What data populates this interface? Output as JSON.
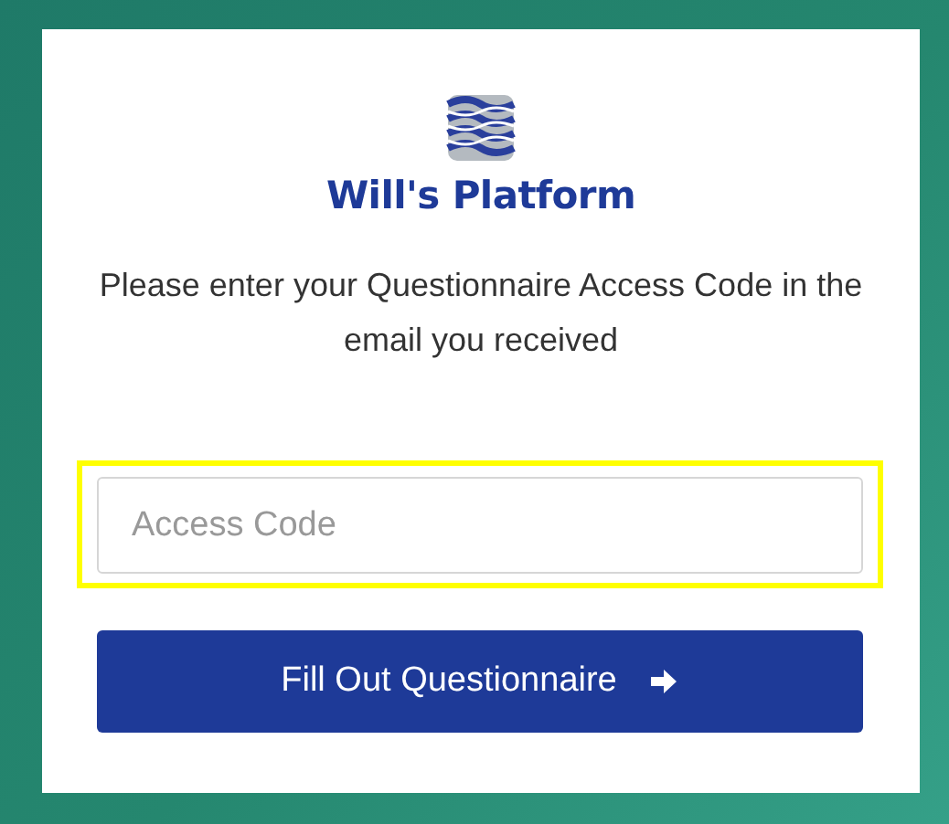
{
  "brand": {
    "name": "Will's Platform"
  },
  "prompt": "Please enter your Questionnaire Access Code in the email you received",
  "access_code": {
    "placeholder": "Access Code",
    "highlighted": true
  },
  "submit_button": {
    "label": "Fill Out Questionnaire"
  }
}
